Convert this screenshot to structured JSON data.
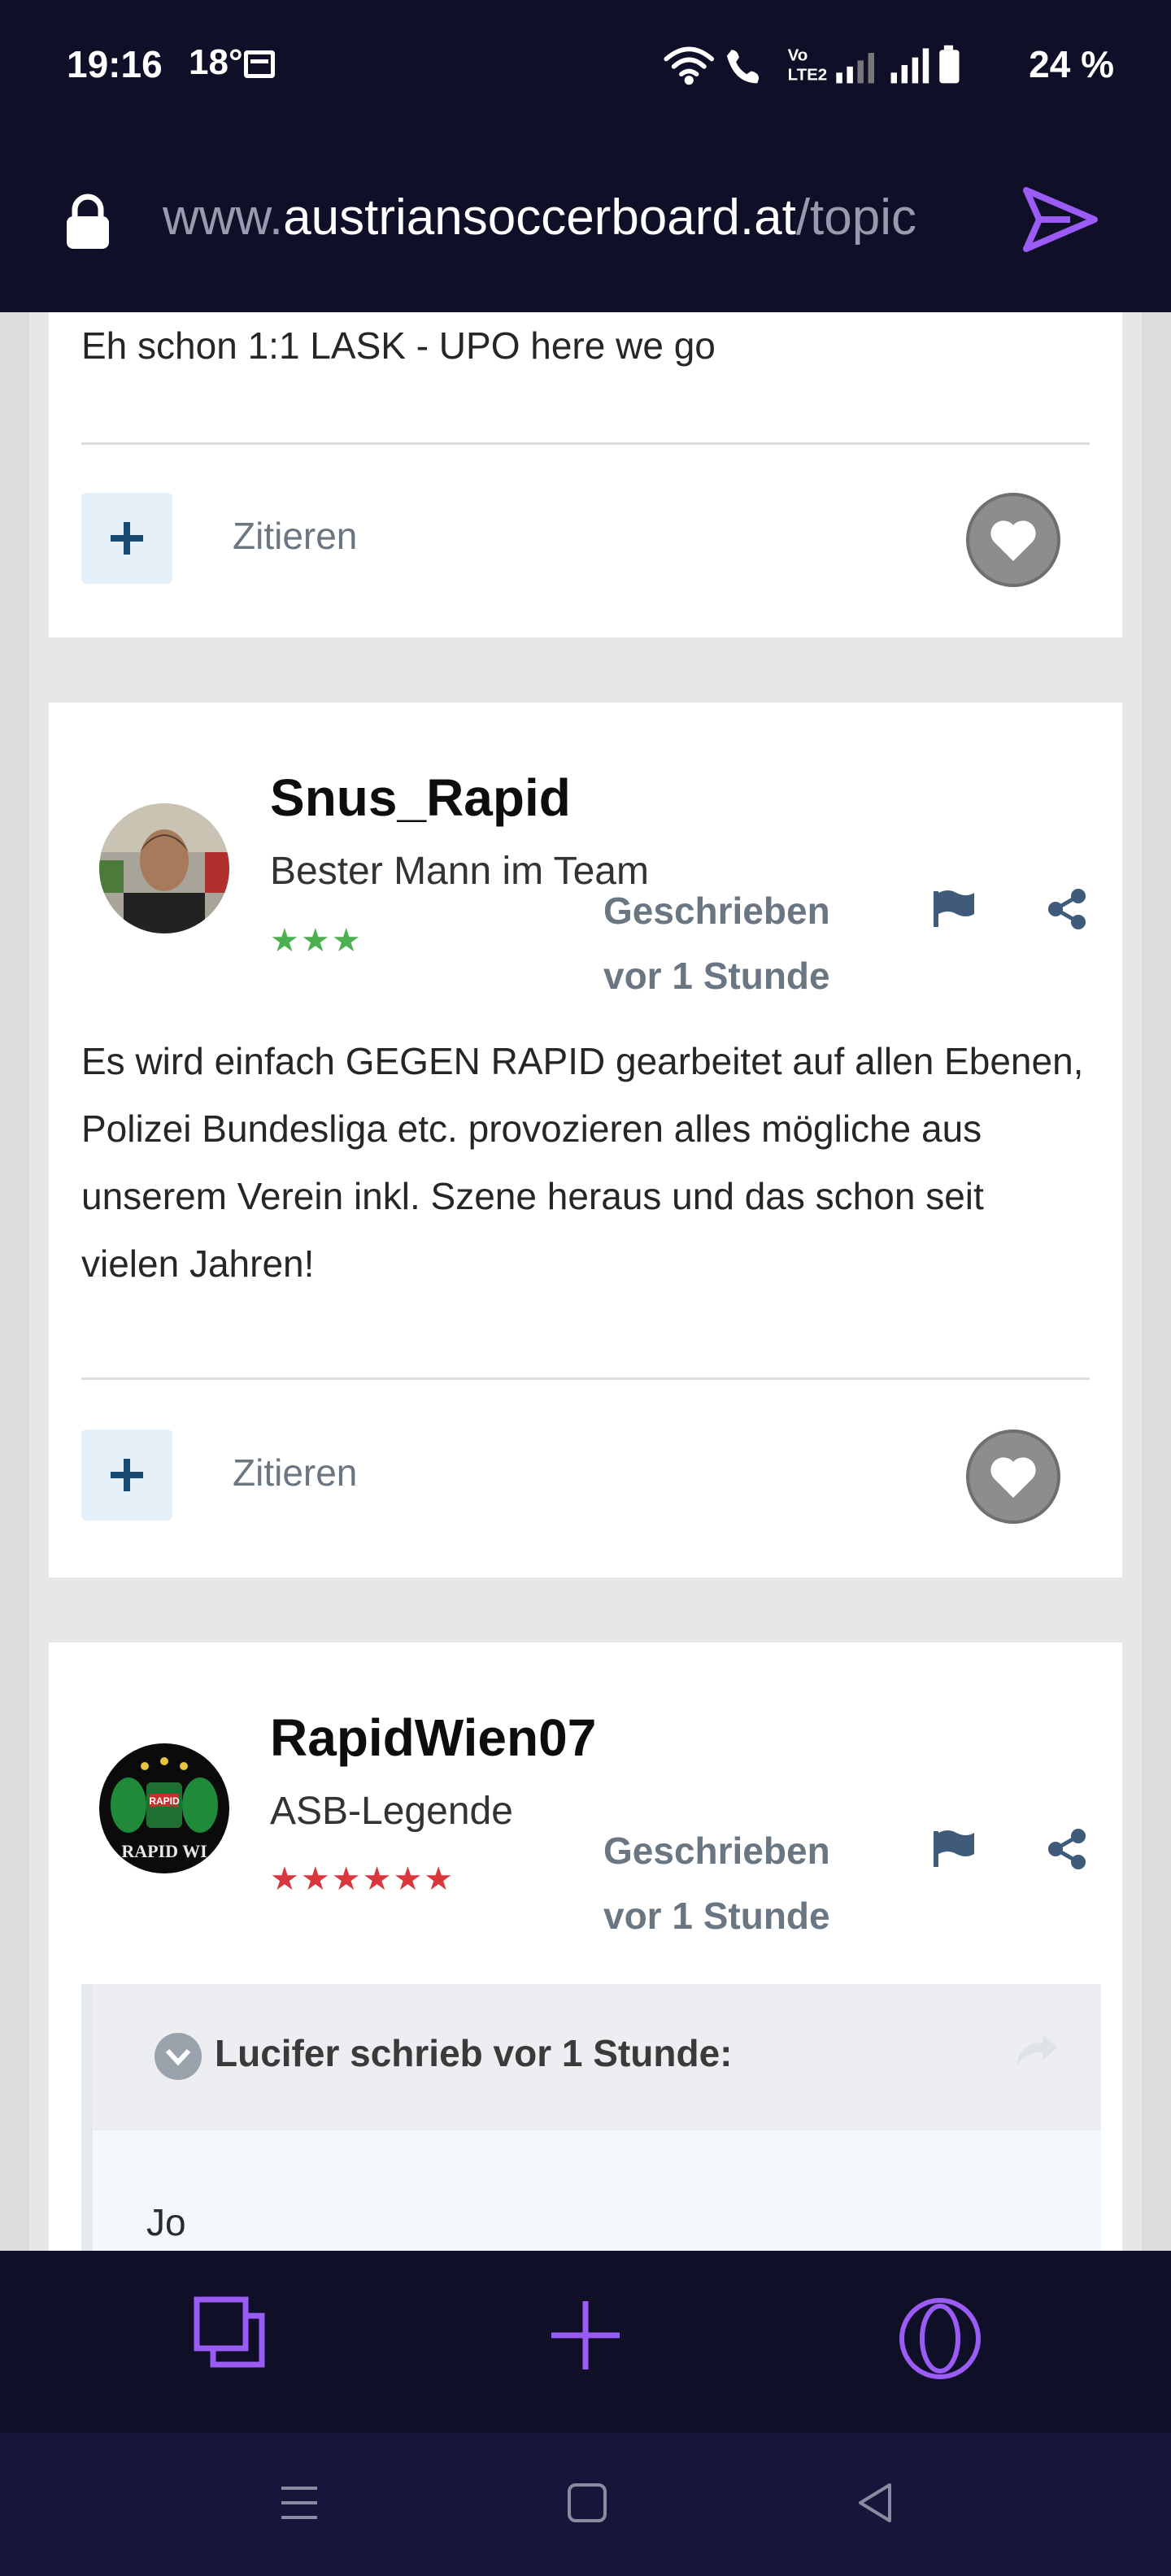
{
  "status_bar": {
    "time": "19:16",
    "temperature": "18°",
    "battery": "24 %",
    "icons": [
      "calendar-icon",
      "wifi-icon",
      "wifi-call-icon",
      "volte-icon",
      "signal-icon",
      "signal-icon",
      "battery-icon"
    ]
  },
  "browser": {
    "url_prefix": "www.",
    "url_domain": "austriansoccerboard.at",
    "url_path": "/topic",
    "icons": [
      "lock-icon",
      "send-icon"
    ]
  },
  "posts": [
    {
      "text": "Eh schon 1:1 LASK - UPO here we go",
      "quote_label": "Zitieren"
    },
    {
      "username": "Snus_Rapid",
      "rank": "Bester Mann im Team",
      "stars": "★★★",
      "star_color": "#4caf50",
      "meta_line1": "Geschrieben",
      "meta_line2": "vor 1 Stunde",
      "text": "Es wird einfach GEGEN RAPID gearbeitet auf allen Ebenen, Polizei Bundesliga etc. provozieren alles mögliche aus unserem Verein inkl. Szene heraus und das schon seit vielen Jahren!",
      "quote_label": "Zitieren"
    },
    {
      "username": "RapidWien07",
      "rank": "ASB-Legende",
      "stars": "★★★★★★",
      "star_color": "#d9363e",
      "meta_line1": "Geschrieben",
      "meta_line2": "vor 1 Stunde",
      "avatar_text": "RAPID WI",
      "quote_author": "Lucifer schrieb vor 1 Stunde:",
      "quote_text": "Jo"
    }
  ],
  "colors": {
    "chrome_bg": "#0f0f28",
    "accent": "#9b5cf6",
    "muted_text": "#6b7683"
  }
}
